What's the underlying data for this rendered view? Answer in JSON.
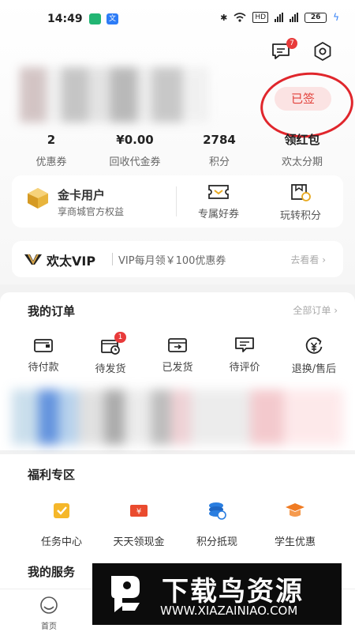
{
  "status_bar": {
    "time": "14:49",
    "hd": "HD",
    "battery": "26"
  },
  "header": {
    "message_badge": "7"
  },
  "profile": {
    "signed_label": "已签",
    "stats": [
      {
        "value": "2",
        "label": "优惠券"
      },
      {
        "value": "¥0.00",
        "label": "回收代金券"
      },
      {
        "value": "2784",
        "label": "积分"
      },
      {
        "value": "领红包",
        "label": "欢太分期"
      }
    ]
  },
  "gold_card": {
    "title": "金卡用户",
    "subtitle": "享商城官方权益",
    "perks": [
      {
        "label": "专属好券",
        "icon": "ticket-icon"
      },
      {
        "label": "玩转积分",
        "icon": "points-icon"
      }
    ]
  },
  "vip": {
    "brand": "欢太VIP",
    "text": "VIP每月领￥100优惠券",
    "link": "去看看 ›"
  },
  "orders": {
    "title": "我的订单",
    "all_link": "全部订单 ›",
    "pending_ship_badge": "1",
    "items": [
      {
        "label": "待付款",
        "icon": "wallet-icon"
      },
      {
        "label": "待发货",
        "icon": "package-clock-icon"
      },
      {
        "label": "已发货",
        "icon": "shipped-box-icon"
      },
      {
        "label": "待评价",
        "icon": "comment-icon"
      },
      {
        "label": "退换/售后",
        "icon": "refund-icon"
      }
    ]
  },
  "welfare": {
    "title": "福利专区",
    "items": [
      {
        "label": "任务中心",
        "icon": "task-icon",
        "color": "#f5b72a"
      },
      {
        "label": "天天领现金",
        "icon": "cash-icon",
        "color": "#ea4b2e"
      },
      {
        "label": "积分抵现",
        "icon": "coins-icon",
        "color": "#2a7ee0"
      },
      {
        "label": "学生优惠",
        "icon": "graduation-cap-icon",
        "color": "#f07b22"
      }
    ]
  },
  "services": {
    "title": "我的服务"
  },
  "tabbar": {
    "home": "首页"
  },
  "watermark": {
    "title": "下载鸟资源",
    "url": "WWW.XIAZAINIAO.COM"
  }
}
